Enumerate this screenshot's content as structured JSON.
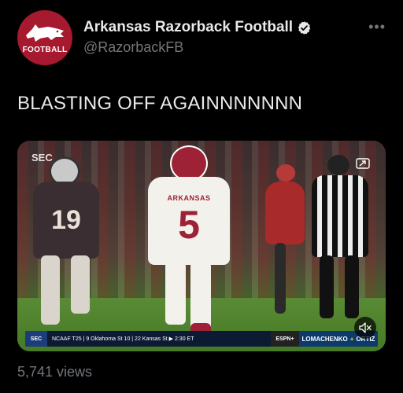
{
  "account": {
    "display_name": "Arkansas Razorback Football",
    "handle": "@RazorbackFB",
    "avatar_text": "FOOTBALL",
    "verified": true
  },
  "tweet": {
    "text": "BLASTING OFF AGAINNNNNNN",
    "views": "5,741 views"
  },
  "video": {
    "watermark": "SEC",
    "player_numbers": [
      "19",
      "5"
    ],
    "jersey_text": "ARKANSAS",
    "scorebug": {
      "ticker": "NCAAF T25 | 9 Oklahoma St 10 | 22 Kansas St ▶ 2:30 ET",
      "network": "ESPN+",
      "matchup_left": "LOMACHENKO",
      "matchup_sep": "+",
      "matchup_right": "ORTIZ"
    }
  },
  "colors": {
    "background": "#000000",
    "text_primary": "#e7e9ea",
    "text_secondary": "#71767b",
    "brand_red": "#a6192e"
  },
  "icons": [
    "hog-logo-icon",
    "verified-badge-icon",
    "more-icon",
    "pip-icon",
    "mute-icon"
  ]
}
